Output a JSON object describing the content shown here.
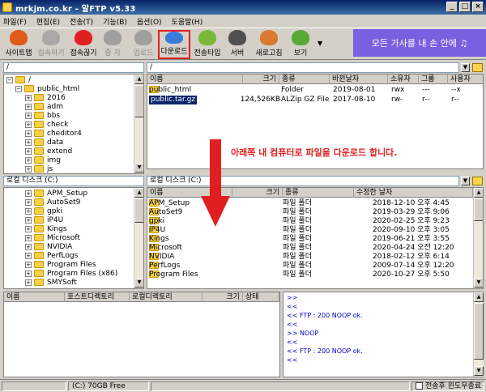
{
  "window": {
    "title": "mrkjm.co.kr - 알FTP v5.33",
    "controls": [
      "_",
      "□",
      "×"
    ]
  },
  "menu": [
    "파일(F)",
    "편집(E)",
    "전송(T)",
    "기능(B)",
    "옵션(O)",
    "도움말(H)"
  ],
  "toolbar": {
    "buttons": [
      {
        "label": "사이트맵",
        "icon": "sitemap-icon",
        "color": "#e05a1a"
      },
      {
        "label": "접속하기",
        "icon": "connect-icon",
        "color": "#d88040"
      },
      {
        "label": "접속끊기",
        "icon": "disconnect-icon",
        "color": "#e02020"
      },
      {
        "label": "중 지",
        "icon": "stop-icon",
        "color": "#808080"
      },
      {
        "label": "업로드",
        "icon": "upload-icon",
        "color": "#808080"
      },
      {
        "label": "다운로드",
        "icon": "download-icon",
        "color": "#3a7ad8"
      },
      {
        "label": "전송타입",
        "icon": "transfer-type-icon",
        "color": "#7ab83a"
      },
      {
        "label": "서버",
        "icon": "server-icon",
        "color": "#505050"
      },
      {
        "label": "새로고침",
        "icon": "refresh-icon",
        "color": "#d87a30"
      },
      {
        "label": "보기",
        "icon": "view-icon",
        "color": "#58a838"
      }
    ],
    "ad": "모든 가사를 내 손 안에 ♫"
  },
  "remote": {
    "tree_path": "/",
    "path": "/",
    "tree": [
      {
        "label": "/",
        "depth": 0,
        "expander": "−"
      },
      {
        "label": "public_html",
        "depth": 1,
        "expander": "−"
      },
      {
        "label": "2016",
        "depth": 2,
        "expander": "+"
      },
      {
        "label": "adm",
        "depth": 2,
        "expander": "+"
      },
      {
        "label": "bbs",
        "depth": 2,
        "expander": "+"
      },
      {
        "label": "check",
        "depth": 2,
        "expander": "+"
      },
      {
        "label": "cheditor4",
        "depth": 2,
        "expander": "+"
      },
      {
        "label": "data",
        "depth": 2,
        "expander": "+"
      },
      {
        "label": "extend",
        "depth": 2,
        "expander": "+"
      },
      {
        "label": "img",
        "depth": 2,
        "expander": "+"
      },
      {
        "label": "js",
        "depth": 2,
        "expander": "+"
      },
      {
        "label": "lib",
        "depth": 2,
        "expander": "+"
      }
    ],
    "columns": [
      "이름",
      "크기",
      "종류",
      "바뀐날자",
      "소유자",
      "그룹",
      "사용자"
    ],
    "files": [
      {
        "name": "public_html",
        "size": "",
        "type": "Folder",
        "date": "2019-08-01",
        "perm": "rwx",
        "group": "---",
        "user": "--x",
        "selected": false
      },
      {
        "name": "public.tar.gz",
        "size": "124,526KB",
        "type": "ALZip GZ File",
        "date": "2017-08-10",
        "perm": "rw-",
        "group": "r--",
        "user": "r--",
        "selected": true
      }
    ]
  },
  "local": {
    "drive": "로컬 디스크 (C:)",
    "path": "로컬 디스크 (C:)",
    "tree": [
      {
        "label": "APM_Setup"
      },
      {
        "label": "AutoSet9"
      },
      {
        "label": "gpki"
      },
      {
        "label": "iP4U"
      },
      {
        "label": "Kings"
      },
      {
        "label": "Microsoft"
      },
      {
        "label": "NVIDIA"
      },
      {
        "label": "PerfLogs"
      },
      {
        "label": "Program Files"
      },
      {
        "label": "Program Files (x86)"
      },
      {
        "label": "SMYSoft"
      }
    ],
    "columns": [
      "이름",
      "크기",
      "종류",
      "수정한 날자"
    ],
    "files": [
      {
        "name": "APM_Setup",
        "type": "파일 폴더",
        "date": "2018-12-10 오후 4:45"
      },
      {
        "name": "AutoSet9",
        "type": "파일 폴더",
        "date": "2019-03-29 오후 9:06"
      },
      {
        "name": "gpki",
        "type": "파일 폴더",
        "date": "2020-02-25 오후 9:23"
      },
      {
        "name": "iP4U",
        "type": "파일 폴더",
        "date": "2020-09-10 오후 3:05"
      },
      {
        "name": "Kings",
        "type": "파일 폴더",
        "date": "2019-06-21 오후 3:55"
      },
      {
        "name": "Microsoft",
        "type": "파일 폴더",
        "date": "2020-04-24 오전 12:20"
      },
      {
        "name": "NVIDIA",
        "type": "파일 폴더",
        "date": "2018-02-12 오후 6:14"
      },
      {
        "name": "PerfLogs",
        "type": "파일 폴더",
        "date": "2009-07-14 오후 12:20"
      },
      {
        "name": "Program Files",
        "type": "파일 폴더",
        "date": "2020-10-27 오후 5:50"
      }
    ]
  },
  "queue": {
    "columns": [
      "이름",
      "호스트디렉토리",
      "로컬디렉토리",
      "크기",
      "상태"
    ]
  },
  "log": [
    ">>",
    "<<",
    "<< FTP : 200 NOOP ok.",
    "<<",
    ">> NOOP",
    "<<",
    "<< FTP : 200 NOOP ok.",
    "<<"
  ],
  "annotation": "아래쪽 내 컴퓨터로 파일을 다운로드 합니다.",
  "status": {
    "drive": "(C:)  70GB Free",
    "close_option": "전송후 윈도우종료"
  }
}
